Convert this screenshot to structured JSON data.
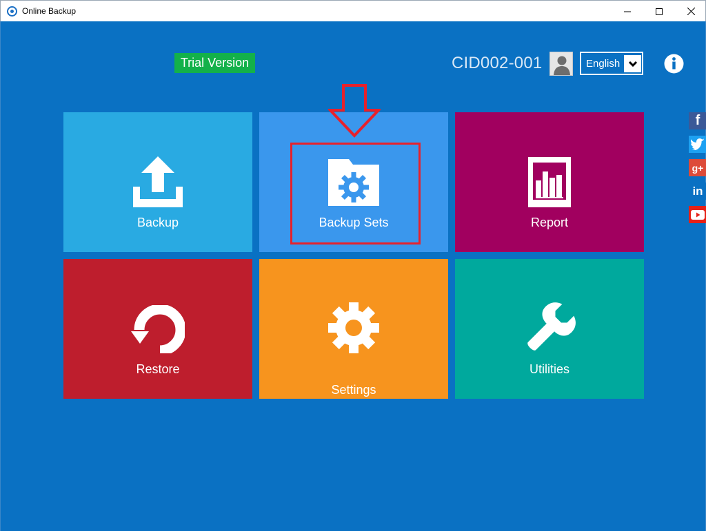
{
  "window": {
    "title": "Online Backup",
    "controls": {
      "minimize": "minimize-icon",
      "maximize": "maximize-icon",
      "close": "close-icon"
    }
  },
  "header": {
    "trial_badge": "Trial Version",
    "user_id": "CID002-001",
    "language": {
      "selected": "English"
    },
    "info_icon": "info-icon"
  },
  "tiles": [
    {
      "label": "Backup",
      "icon": "upload-icon",
      "color": "#29aae2"
    },
    {
      "label": "Backup Sets",
      "icon": "folder-gear-icon",
      "color": "#3a97ed"
    },
    {
      "label": "Report",
      "icon": "bar-chart-icon",
      "color": "#a1005f"
    },
    {
      "label": "Restore",
      "icon": "restore-icon",
      "color": "#be1e2d"
    },
    {
      "label": "Settings",
      "icon": "gear-icon",
      "color": "#f7941e"
    },
    {
      "label": "Utilities",
      "icon": "wrench-icon",
      "color": "#00a99d"
    }
  ],
  "social": [
    "facebook-icon",
    "twitter-icon",
    "google-plus-icon",
    "linkedin-icon",
    "youtube-icon"
  ],
  "social_glyphs": {
    "facebook": "f",
    "googleplus": "g+",
    "linkedin": "in"
  },
  "colors": {
    "background": "#0a71c3",
    "trial_badge": "#13b14a",
    "annotation": "#e8212b"
  }
}
